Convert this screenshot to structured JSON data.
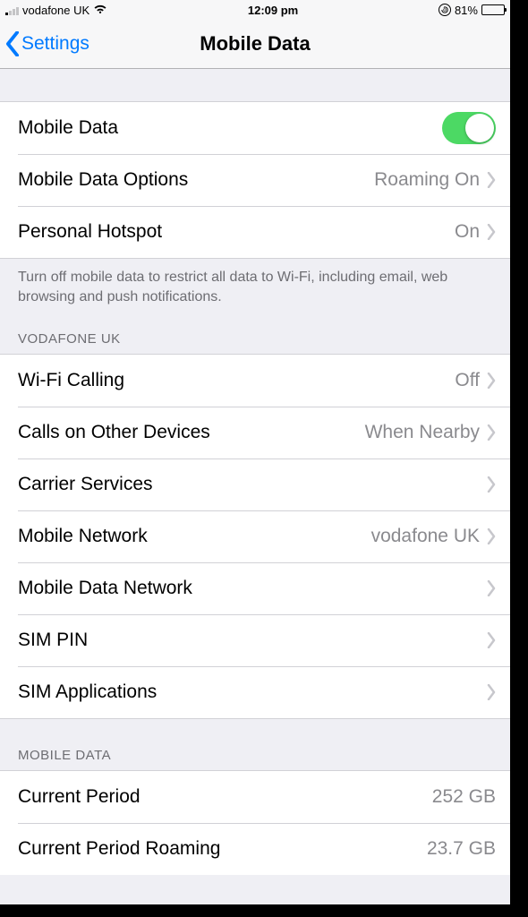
{
  "statusBar": {
    "carrier": "vodafone UK",
    "time": "12:09 pm",
    "batteryPct": "81%"
  },
  "nav": {
    "back": "Settings",
    "title": "Mobile Data"
  },
  "group1": {
    "mobileData": "Mobile Data",
    "options": {
      "label": "Mobile Data Options",
      "value": "Roaming On"
    },
    "hotspot": {
      "label": "Personal Hotspot",
      "value": "On"
    },
    "footer": "Turn off mobile data to restrict all data to Wi-Fi, including email, web browsing and push notifications."
  },
  "vodafone": {
    "header": "VODAFONE UK",
    "wifiCalling": {
      "label": "Wi-Fi Calling",
      "value": "Off"
    },
    "callsOther": {
      "label": "Calls on Other Devices",
      "value": "When Nearby"
    },
    "carrierServices": "Carrier Services",
    "mobileNetwork": {
      "label": "Mobile Network",
      "value": "vodafone UK"
    },
    "dataNetwork": "Mobile Data Network",
    "simPin": "SIM PIN",
    "simApps": "SIM Applications"
  },
  "usage": {
    "header": "MOBILE DATA",
    "currentPeriod": {
      "label": "Current Period",
      "value": "252 GB"
    },
    "roaming": {
      "label": "Current Period Roaming",
      "value": "23.7 GB"
    }
  }
}
